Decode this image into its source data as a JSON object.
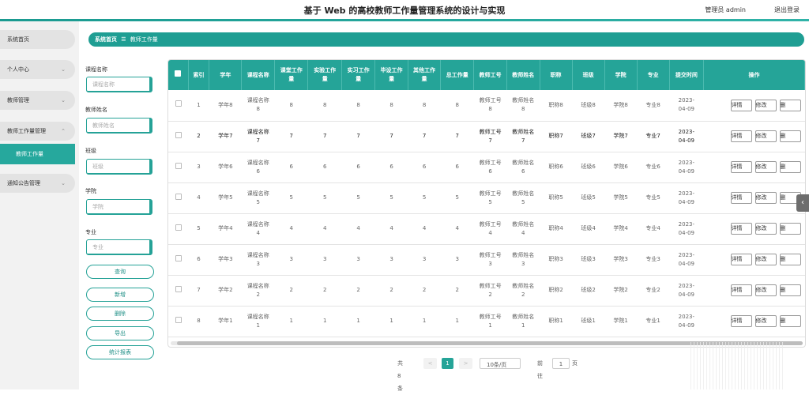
{
  "header": {
    "title": "基于 Web 的高校教师工作量管理系统的设计与实现",
    "admin": "管理员 admin",
    "logout": "退出登录"
  },
  "sidebar": {
    "items": [
      {
        "label": "系统首页",
        "chevron": ""
      },
      {
        "label": "个人中心",
        "chevron": "⌄"
      },
      {
        "label": "教师管理",
        "chevron": "⌄"
      },
      {
        "label": "教师工作量管理",
        "chevron": "⌃"
      },
      {
        "label": "通知公告管理",
        "chevron": "⌄"
      }
    ],
    "subitem": "教师工作量"
  },
  "breadcrumb": {
    "home": "系统首页",
    "sep": "☰",
    "current": "教师工作量"
  },
  "search": {
    "course_label": "课程名称",
    "course_placeholder": "课程名称",
    "teacher_label": "教师姓名",
    "teacher_placeholder": "教师姓名",
    "class_label": "班级",
    "class_placeholder": "班级",
    "college_label": "学院",
    "college_placeholder": "学院",
    "major_label": "专业",
    "major_placeholder": "专业",
    "query_btn": "查询"
  },
  "actions": {
    "add": "新增",
    "delete": "删除",
    "export": "导出",
    "stats": "统计报表"
  },
  "table": {
    "headers": [
      "",
      "索引",
      "学年",
      "课程名称",
      "课堂工作量",
      "实验工作量",
      "实习工作量",
      "毕设工作量",
      "其他工作量",
      "总工作量",
      "教师工号",
      "教师姓名",
      "职称",
      "班级",
      "学院",
      "专业",
      "提交时间",
      "操作"
    ],
    "op_labels": [
      "详情",
      "修改",
      "删"
    ],
    "rows": [
      [
        "",
        "1",
        "学年8",
        "课程名称8",
        "8",
        "8",
        "8",
        "8",
        "8",
        "8",
        "教师工号8",
        "教师姓名8",
        "职称8",
        "班级8",
        "学院8",
        "专业8",
        "2023-04-09"
      ],
      [
        "",
        "2",
        "学年7",
        "课程名称7",
        "7",
        "7",
        "7",
        "7",
        "7",
        "7",
        "教师工号7",
        "教师姓名7",
        "职称7",
        "班级7",
        "学院7",
        "专业7",
        "2023-04-09"
      ],
      [
        "",
        "3",
        "学年6",
        "课程名称6",
        "6",
        "6",
        "6",
        "6",
        "6",
        "6",
        "教师工号6",
        "教师姓名6",
        "职称6",
        "班级6",
        "学院6",
        "专业6",
        "2023-04-09"
      ],
      [
        "",
        "4",
        "学年5",
        "课程名称5",
        "5",
        "5",
        "5",
        "5",
        "5",
        "5",
        "教师工号5",
        "教师姓名5",
        "职称5",
        "班级5",
        "学院5",
        "专业5",
        "2023-04-09"
      ],
      [
        "",
        "5",
        "学年4",
        "课程名称4",
        "4",
        "4",
        "4",
        "4",
        "4",
        "4",
        "教师工号4",
        "教师姓名4",
        "职称4",
        "班级4",
        "学院4",
        "专业4",
        "2023-04-09"
      ],
      [
        "",
        "6",
        "学年3",
        "课程名称3",
        "3",
        "3",
        "3",
        "3",
        "3",
        "3",
        "教师工号3",
        "教师姓名3",
        "职称3",
        "班级3",
        "学院3",
        "专业3",
        "2023-04-09"
      ],
      [
        "",
        "7",
        "学年2",
        "课程名称2",
        "2",
        "2",
        "2",
        "2",
        "2",
        "2",
        "教师工号2",
        "教师姓名2",
        "职称2",
        "班级2",
        "学院2",
        "专业2",
        "2023-04-09"
      ],
      [
        "",
        "8",
        "学年1",
        "课程名称1",
        "1",
        "1",
        "1",
        "1",
        "1",
        "1",
        "教师工号1",
        "教师姓名1",
        "职称1",
        "班级1",
        "学院1",
        "专业1",
        "2023-04-09"
      ]
    ]
  },
  "pagination": {
    "total": "共 8 条",
    "prev": "<",
    "page": "1",
    "next": ">",
    "size": "10条/页",
    "goto": "前往",
    "goto_value": "1",
    "goto_unit": "页"
  },
  "colors": {
    "accent": "#25a498"
  }
}
